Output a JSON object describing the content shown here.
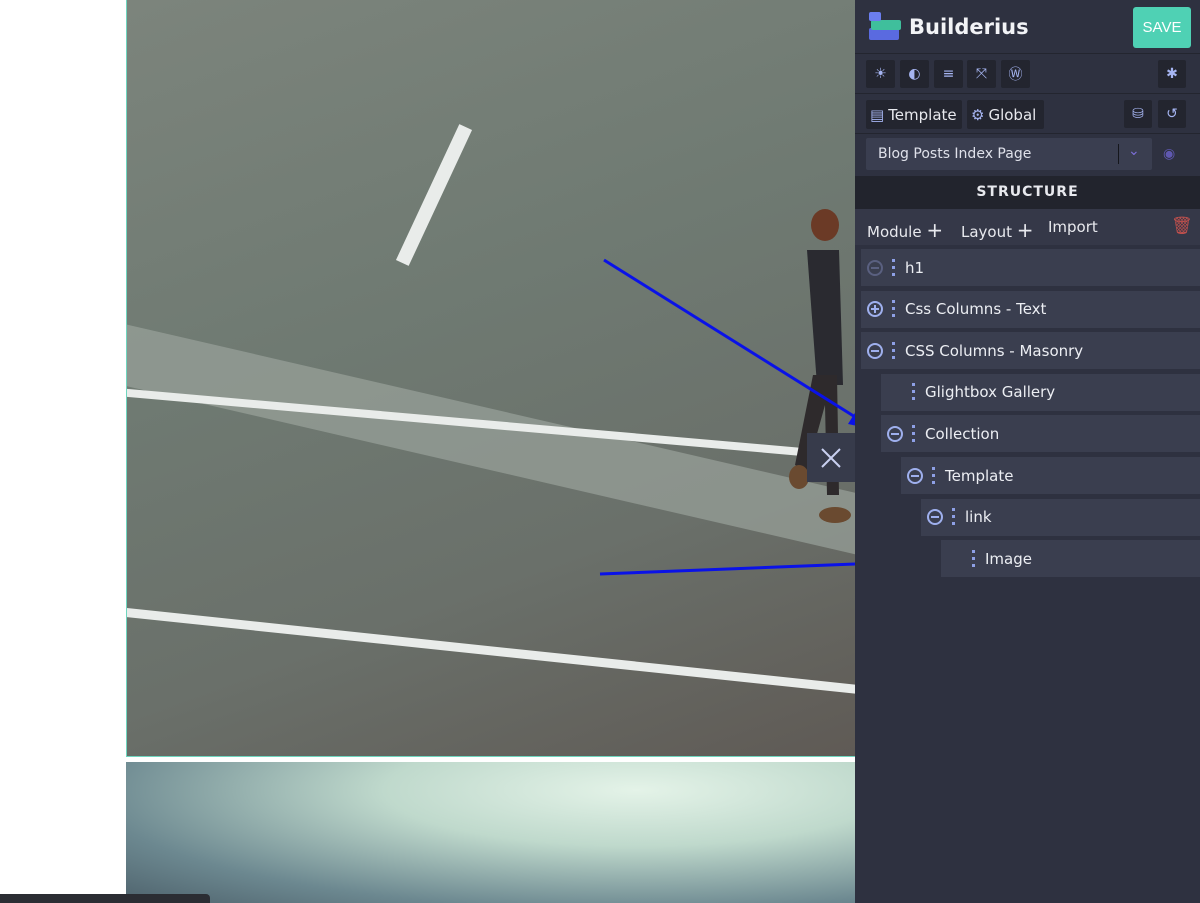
{
  "app": {
    "name": "Builderius",
    "save_label": "SAVE"
  },
  "toolbar": {
    "icons": [
      "sun-icon",
      "contrast-icon",
      "align-right-icon",
      "expand-icon",
      "wordpress-icon",
      "bug-icon"
    ]
  },
  "tabs": {
    "template_label": "Template",
    "global_label": "Global"
  },
  "template_select": {
    "value": "Blog Posts Index Page"
  },
  "structure": {
    "title": "STRUCTURE",
    "module_label": "Module",
    "layout_label": "Layout",
    "import_label": "Import"
  },
  "tree": [
    {
      "label": "h1",
      "depth": 0,
      "toggle": "collapse-disabled"
    },
    {
      "label": "Css Columns - Text",
      "depth": 0,
      "toggle": "expand"
    },
    {
      "label": "CSS Columns - Masonry",
      "depth": 0,
      "toggle": "collapse"
    },
    {
      "label": "Glightbox Gallery",
      "depth": 1,
      "toggle": "none"
    },
    {
      "label": "Collection",
      "depth": 1,
      "toggle": "collapse"
    },
    {
      "label": "Template",
      "depth": 2,
      "toggle": "collapse"
    },
    {
      "label": "link",
      "depth": 3,
      "toggle": "collapse"
    },
    {
      "label": "Image",
      "depth": 4,
      "toggle": "none"
    }
  ],
  "colors": {
    "accent": "#4fd1b4",
    "panel": "#2e3140",
    "icon": "#a6b5f2",
    "arrow": "#0a12e8",
    "delete": "#c0504d"
  }
}
